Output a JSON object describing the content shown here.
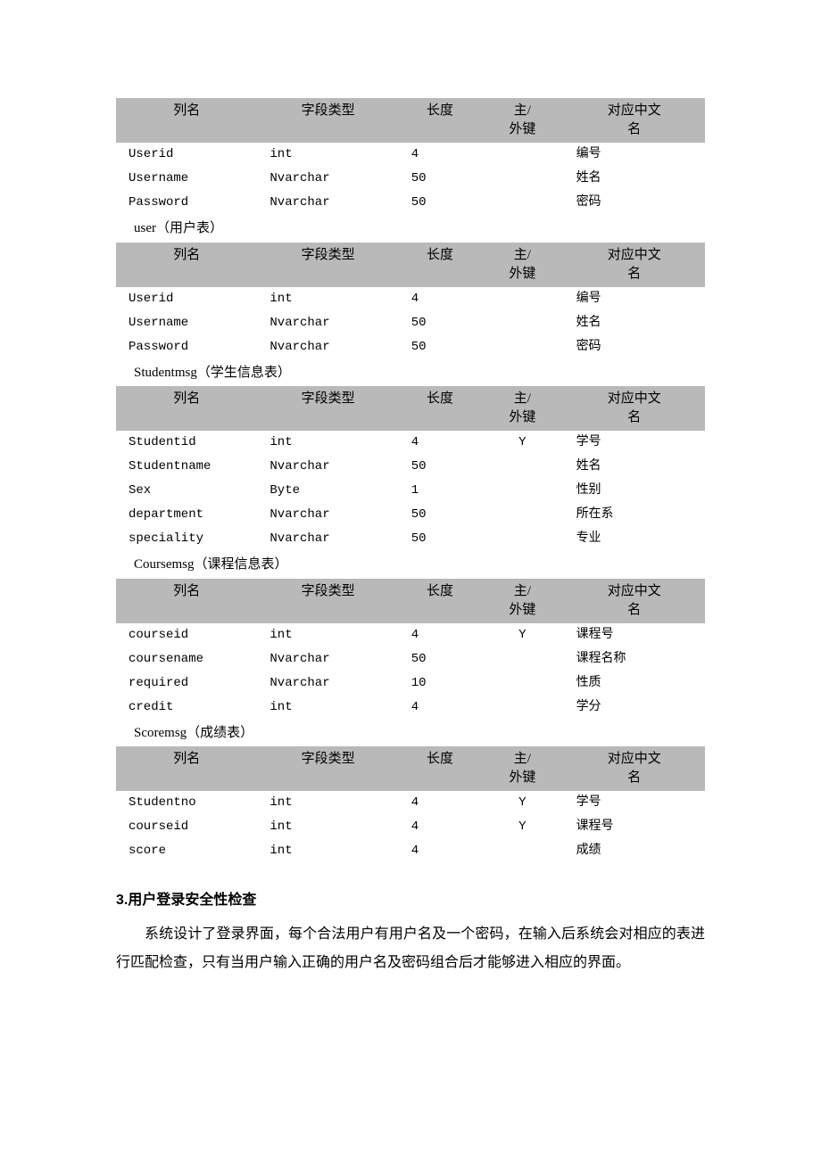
{
  "headers": {
    "col1": "列名",
    "col2": "字段类型",
    "col3": "长度",
    "col4a": "主/",
    "col4b": "外键",
    "col5a": "对应中文",
    "col5b": "名"
  },
  "tables": [
    {
      "caption": "user（用户表）",
      "rows": [
        {
          "c1": "Userid",
          "c2": "int",
          "c3": "4",
          "c4": "",
          "c5": "编号"
        },
        {
          "c1": "Username",
          "c2": "Nvarchar",
          "c3": "50",
          "c4": "",
          "c5": "姓名"
        },
        {
          "c1": "Password",
          "c2": "Nvarchar",
          "c3": "50",
          "c4": "",
          "c5": "密码"
        }
      ]
    },
    {
      "caption": "Studentmsg（学生信息表）",
      "rows": [
        {
          "c1": "Userid",
          "c2": "int",
          "c3": "4",
          "c4": "",
          "c5": "编号"
        },
        {
          "c1": "Username",
          "c2": "Nvarchar",
          "c3": "50",
          "c4": "",
          "c5": "姓名"
        },
        {
          "c1": "Password",
          "c2": "Nvarchar",
          "c3": "50",
          "c4": "",
          "c5": "密码"
        }
      ]
    },
    {
      "caption": "Coursemsg（课程信息表）",
      "rows": [
        {
          "c1": "Studentid",
          "c2": "int",
          "c3": "4",
          "c4": "Y",
          "c5": "学号"
        },
        {
          "c1": "Studentname",
          "c2": "Nvarchar",
          "c3": "50",
          "c4": "",
          "c5": "姓名"
        },
        {
          "c1": "Sex",
          "c2": "Byte",
          "c3": "1",
          "c4": "",
          "c5": "性别"
        },
        {
          "c1": "department",
          "c2": "Nvarchar",
          "c3": "50",
          "c4": "",
          "c5": "所在系"
        },
        {
          "c1": "speciality",
          "c2": "Nvarchar",
          "c3": "50",
          "c4": "",
          "c5": "专业"
        }
      ]
    },
    {
      "caption": "Scoremsg（成绩表）",
      "rows": [
        {
          "c1": "courseid",
          "c2": "int",
          "c3": "4",
          "c4": "Y",
          "c5": "课程号"
        },
        {
          "c1": "coursename",
          "c2": "Nvarchar",
          "c3": "50",
          "c4": "",
          "c5": "课程名称"
        },
        {
          "c1": "required",
          "c2": "Nvarchar",
          "c3": "10",
          "c4": "",
          "c5": "性质"
        },
        {
          "c1": "credit",
          "c2": "int",
          "c3": "4",
          "c4": "",
          "c5": "学分"
        }
      ]
    },
    {
      "caption": "",
      "rows": [
        {
          "c1": "Studentno",
          "c2": "int",
          "c3": "4",
          "c4": "Y",
          "c5": "学号"
        },
        {
          "c1": "courseid",
          "c2": "int",
          "c3": "4",
          "c4": "Y",
          "c5": "课程号"
        },
        {
          "c1": "score",
          "c2": "int",
          "c3": "4",
          "c4": "",
          "c5": "成绩"
        }
      ]
    }
  ],
  "section_heading": "3.用户登录安全性检查",
  "paragraph": "系统设计了登录界面，每个合法用户有用户名及一个密码，在输入后系统会对相应的表进行匹配检查，只有当用户输入正确的用户名及密码组合后才能够进入相应的界面。"
}
